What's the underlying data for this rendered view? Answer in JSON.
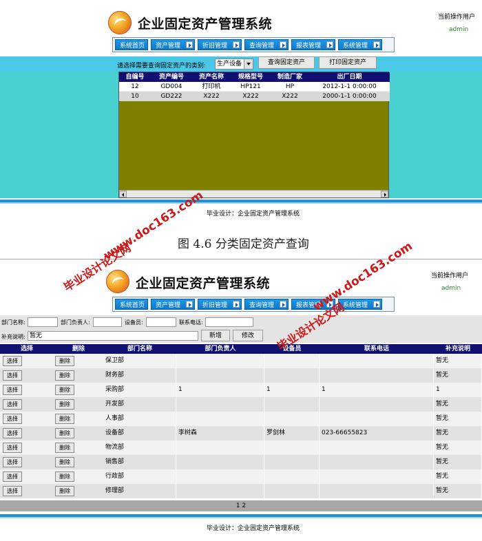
{
  "app": {
    "title": "企业固定资产管理系统",
    "current_user_label": "当前操作用户",
    "current_user": "admin"
  },
  "menu": [
    "系统首页",
    "资产管理",
    "折旧管理",
    "查询管理",
    "报表管理",
    "系统管理"
  ],
  "query": {
    "prompt": "请选择需要查询固定资产的类别:",
    "category": "生产设备",
    "query_button": "查询固定资产",
    "print_button": "打印固定资产",
    "columns": [
      "自编号",
      "资产编号",
      "资产名称",
      "规格型号",
      "制造厂家",
      "出厂日期"
    ],
    "rows": [
      [
        "12",
        "GD004",
        "打印机",
        "HP121",
        "HP",
        "2012-1-1 0:00:00"
      ],
      [
        "10",
        "GD222",
        "X222",
        "X222",
        "X222",
        "2000-1-1 0:00:00"
      ]
    ]
  },
  "footer": "毕业设计：企业固定资产管理系统",
  "caption": "图 4.6 分类固定资产查询",
  "dept": {
    "labels": {
      "name": "部门名称:",
      "head": "部门负责人:",
      "equip": "设备员:",
      "phone": "联系电话:",
      "note": "补充说明:"
    },
    "note_value": "暂无",
    "add_button": "新增",
    "edit_button": "修改",
    "columns": [
      "选择",
      "删除",
      "部门名称",
      "部门负责人",
      "设备员",
      "联系电话",
      "补充说明"
    ],
    "select_label": "选择",
    "delete_label": "删除",
    "rows": [
      {
        "name": "保卫部",
        "head": "",
        "equip": "",
        "phone": "",
        "note": "暂无"
      },
      {
        "name": "财务部",
        "head": "",
        "equip": "",
        "phone": "",
        "note": "暂无"
      },
      {
        "name": "采购部",
        "head": "1",
        "equip": "1",
        "phone": "1",
        "note": "1"
      },
      {
        "name": "开发部",
        "head": "",
        "equip": "",
        "phone": "",
        "note": "暂无"
      },
      {
        "name": "人事部",
        "head": "",
        "equip": "",
        "phone": "",
        "note": "暂无"
      },
      {
        "name": "设备部",
        "head": "李树森",
        "equip": "罗剑林",
        "phone": "023-66655823",
        "note": "暂无"
      },
      {
        "name": "物流部",
        "head": "",
        "equip": "",
        "phone": "",
        "note": "暂无"
      },
      {
        "name": "销售部",
        "head": "",
        "equip": "",
        "phone": "",
        "note": "暂无"
      },
      {
        "name": "行政部",
        "head": "",
        "equip": "",
        "phone": "",
        "note": "暂无"
      },
      {
        "name": "修理部",
        "head": "",
        "equip": "",
        "phone": "",
        "note": "暂无"
      }
    ],
    "pager": "1 2"
  },
  "watermarks": {
    "site": "www.doc163.com",
    "brand": "毕业设计论文网"
  },
  "colors": {
    "menu_blue": "#1278c8",
    "grid_header": "#101070",
    "teal": "#49d0d0",
    "olive": "#808000",
    "watermark_red": "#d01818"
  }
}
